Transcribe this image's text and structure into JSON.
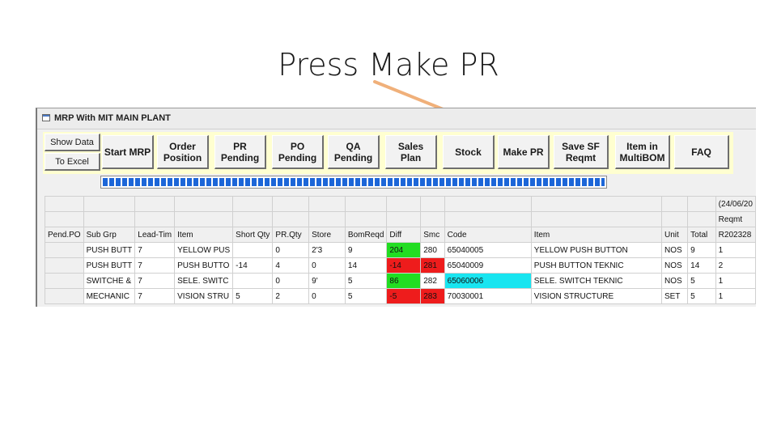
{
  "slide": {
    "title": "Press Make PR"
  },
  "window": {
    "title": "MRP With MIT MAIN PLANT"
  },
  "toolbar": {
    "show_data": "Show Data",
    "to_excel": "To Excel",
    "start_mrp": "Start MRP",
    "order_position": "Order\nPosition",
    "pr_pending": "PR\nPending",
    "po_pending": "PO\nPending",
    "qa_pending": "QA\nPending",
    "sales_plan": "Sales\nPlan",
    "stock": "Stock",
    "make_pr": "Make PR",
    "save_sf_reqmt": "Save SF\nReqmt",
    "item_in_multibom": "Item in\nMultiBOM",
    "faq": "FAQ"
  },
  "progress": {
    "percent": 100
  },
  "grid": {
    "top_right_date": "(24/06/20",
    "top_right_label": "Reqmt",
    "headers": [
      "Pend.PO",
      "Sub Grp",
      "Lead-Tim",
      "Item",
      "Short Qty",
      "PR.Qty",
      "Store",
      "BomReqd",
      "Diff",
      "Smc",
      "Code",
      "Item",
      "Unit",
      "Total",
      "R202328"
    ],
    "rows": [
      [
        "",
        "PUSH BUTT",
        "7",
        "YELLOW PUS",
        "",
        "0",
        "2'3",
        "9",
        "204",
        "280",
        "65040005",
        "YELLOW PUSH BUTTON",
        "NOS",
        "9",
        "1"
      ],
      [
        "",
        "PUSH BUTT",
        "7",
        "PUSH BUTTO",
        "-14",
        "4",
        "0",
        "14",
        "-14",
        "281",
        "65040009",
        "PUSH BUTTON TEKNIC",
        "NOS",
        "14",
        "2"
      ],
      [
        "",
        "SWITCHE &",
        "7",
        "SELE. SWITC",
        "",
        "0",
        "9'",
        "5",
        "86",
        "282",
        "65060006",
        "SELE. SWITCH TEKNIC",
        "NOS",
        "5",
        "1"
      ],
      [
        "",
        "MECHANIC",
        "7",
        "VISION STRU",
        "5",
        "2",
        "0",
        "5",
        "-5",
        "283",
        "70030001",
        "VISION STRUCTURE",
        "SET",
        "5",
        "1"
      ]
    ],
    "cell_colors": {
      "green": "#22dd22",
      "red": "#ee1c1c",
      "cyan": "#18e5f0"
    }
  }
}
